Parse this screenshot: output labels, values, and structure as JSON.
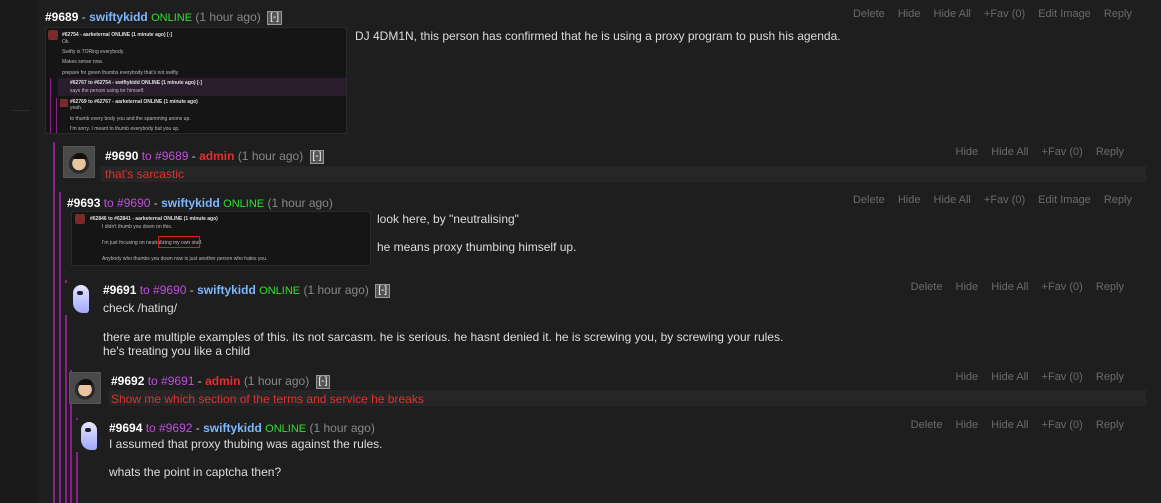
{
  "posts": [
    {
      "num": "#9689",
      "dash1": "-",
      "user": "swiftykidd",
      "online": "ONLINE",
      "time": "(1 hour ago)",
      "collapse": "[-]",
      "actions": [
        "Delete",
        "Hide",
        "Hide All",
        "+Fav (0)",
        "Edit Image",
        "Reply"
      ],
      "text": "DJ 4DM1N, this person has confirmed that he is using a proxy program to push his agenda."
    },
    {
      "num": "#9690",
      "to": "to #9689",
      "dash1": "-",
      "user": "admin",
      "time": "(1 hour ago)",
      "collapse": "[-]",
      "actions": [
        "Hide",
        "Hide All",
        "+Fav (0)",
        "Reply"
      ],
      "text": "that's sarcastic"
    },
    {
      "num": "#9693",
      "to": "to #9690",
      "dash1": "-",
      "user": "swiftykidd",
      "online": "ONLINE",
      "time": "(1 hour ago)",
      "actions": [
        "Delete",
        "Hide",
        "Hide All",
        "+Fav (0)",
        "Edit Image",
        "Reply"
      ],
      "text1": "look here, by \"neutralising\"",
      "text2": "he means proxy thumbing himself up."
    },
    {
      "num": "#9691",
      "to": "to #9690",
      "dash1": "-",
      "user": "swiftykidd",
      "online": "ONLINE",
      "time": "(1 hour ago)",
      "collapse": "[-]",
      "actions": [
        "Delete",
        "Hide",
        "Hide All",
        "+Fav (0)",
        "Reply"
      ],
      "line1": "check /hating/",
      "line2": "there are multiple examples of this. its not sarcasm. he is serious. he hasnt denied it. he is screwing you, by screwing your rules.",
      "line3": "he's treating you like a child"
    },
    {
      "num": "#9692",
      "to": "to #9691",
      "dash1": "-",
      "user": "admin",
      "time": "(1 hour ago)",
      "collapse": "[-]",
      "actions": [
        "Hide",
        "Hide All",
        "+Fav (0)",
        "Reply"
      ],
      "text": "Show me which section of the terms and service he breaks"
    },
    {
      "num": "#9694",
      "to": "to #9692",
      "dash1": "-",
      "user": "swiftykidd",
      "online": "ONLINE",
      "time": "(1 hour ago)",
      "actions": [
        "Delete",
        "Hide",
        "Hide All",
        "+Fav (0)",
        "Reply"
      ],
      "line1": "I assumed that proxy thubing was against the rules.",
      "line2": "whats the point in captcha then?"
    }
  ],
  "thumb1": {
    "l1": "#62754 - aarketernal ONLINE (1 minute ago) [-]",
    "l2": "Ok.",
    "l3": "Swifty is TORing everybody.",
    "l4": "Makes sense now.",
    "l5": "prepare for green thumbs everybody that's not swifty",
    "l6": "#62767 to #62754 - swiftykidd ONLINE (1 minute ago) [-]",
    "l7": "says the person using tor himself.",
    "l8": "#62769 to #62767 - aarketernal ONLINE (1 minute ago)",
    "l9": "yeah.",
    "l10": "to thumb every body you and the spamming anons up.",
    "l11": "I'm sorry. I meant to thumb everybody but you up."
  },
  "thumb2": {
    "l1": "#62846 to #62841 - aarketernal ONLINE (1 minute ago)",
    "l2": "I didn't thumb you down on this.",
    "l3": "I'm just focusing on neutralizing my own stuff.",
    "l4": "Anybody who thumbs you down now is just another person who hates you."
  },
  "colors": {
    "user": "#7fb8ff",
    "admin": "#e03030",
    "online": "#33dd33",
    "to": "#c050e0",
    "thread_bar": "#8a1f8a"
  }
}
